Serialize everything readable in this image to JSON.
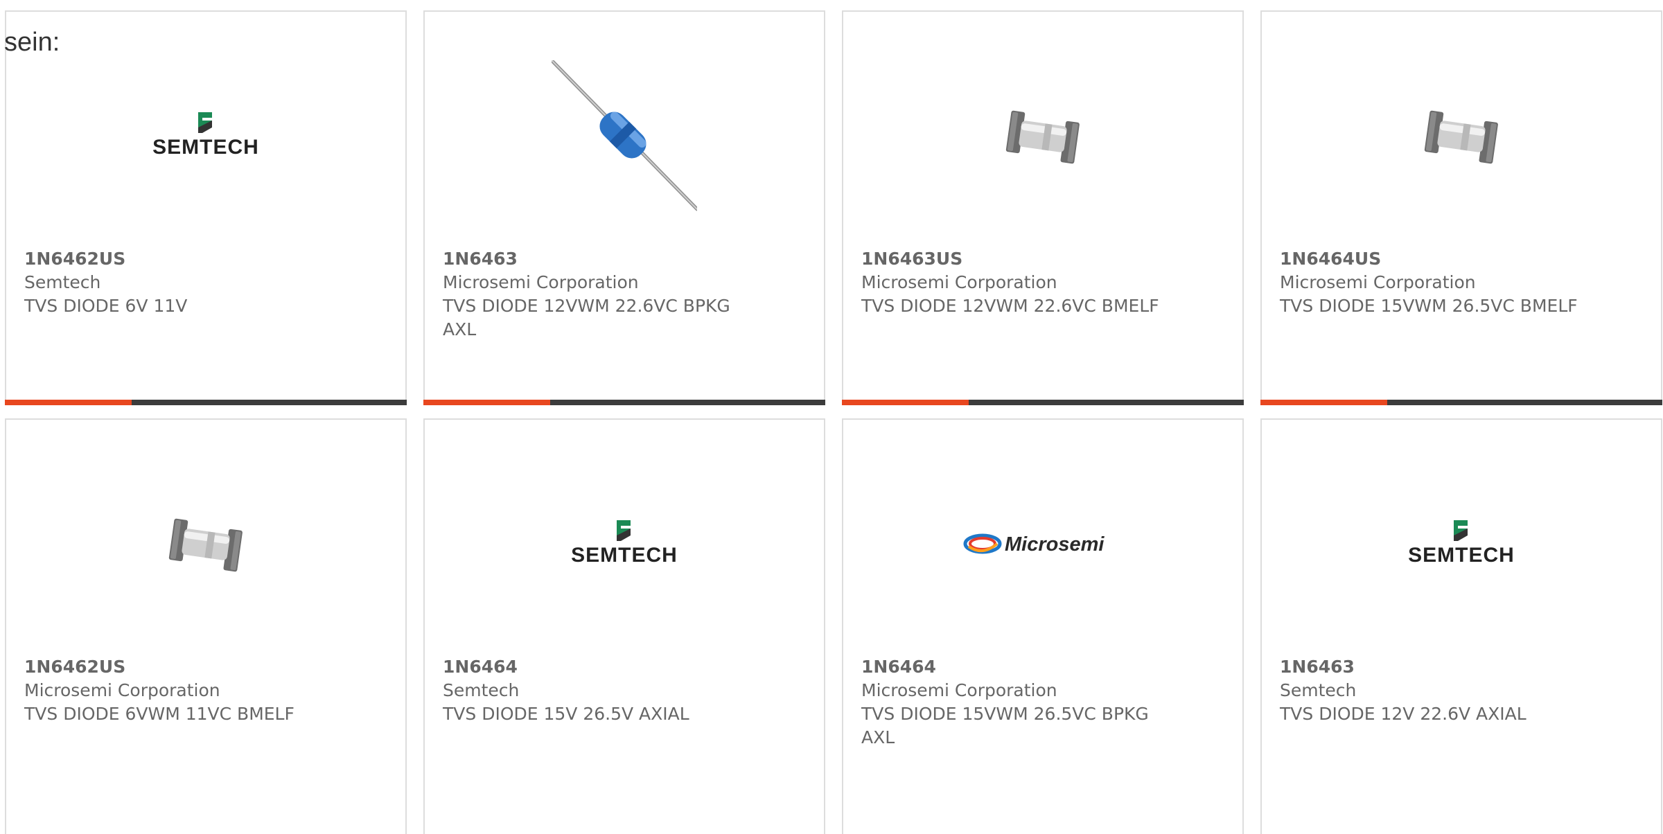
{
  "page": {
    "intro_text": "sein:"
  },
  "colors": {
    "accent": "#e8471f",
    "bar_dark": "#3c3c3c",
    "card_border": "#dddddd",
    "text": "#666666",
    "semtech_green": "#1b8a55",
    "diode_blue": "#2d74c6"
  },
  "products": [
    {
      "part_number": "1N6462US",
      "manufacturer": "Semtech",
      "description": "TVS DIODE 6V 11V",
      "image": "semtech-logo",
      "logo_text": "SEMTECH"
    },
    {
      "part_number": "1N6463",
      "manufacturer": "Microsemi Corporation",
      "description": "TVS DIODE 12VWM 22.6VC BPKG AXL",
      "image": "axial-diode-blue"
    },
    {
      "part_number": "1N6463US",
      "manufacturer": "Microsemi Corporation",
      "description": "TVS DIODE 12VWM 22.6VC BMELF",
      "image": "melf-diode"
    },
    {
      "part_number": "1N6464US",
      "manufacturer": "Microsemi Corporation",
      "description": "TVS DIODE 15VWM 26.5VC BMELF",
      "image": "melf-diode"
    },
    {
      "part_number": "1N6462US",
      "manufacturer": "Microsemi Corporation",
      "description": "TVS DIODE 6VWM 11VC BMELF",
      "image": "melf-diode"
    },
    {
      "part_number": "1N6464",
      "manufacturer": "Semtech",
      "description": "TVS DIODE 15V 26.5V AXIAL",
      "image": "semtech-logo",
      "logo_text": "SEMTECH"
    },
    {
      "part_number": "1N6464",
      "manufacturer": "Microsemi Corporation",
      "description": "TVS DIODE 15VWM 26.5VC BPKG AXL",
      "image": "microsemi-logo",
      "logo_text": "Microsemi"
    },
    {
      "part_number": "1N6463",
      "manufacturer": "Semtech",
      "description": "TVS DIODE 12V 22.6V AXIAL",
      "image": "semtech-logo",
      "logo_text": "SEMTECH"
    }
  ]
}
